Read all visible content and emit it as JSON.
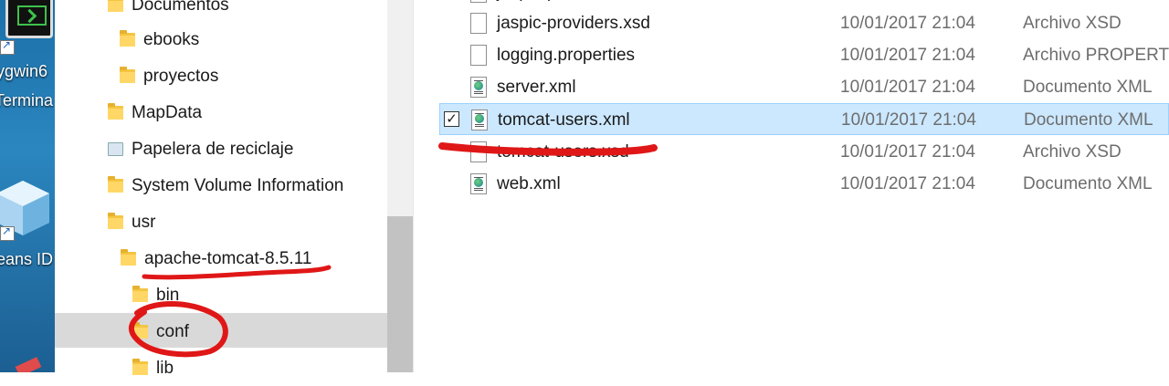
{
  "desktop": {
    "label_cygwin": "ygwin6",
    "label_terminal": "Termina",
    "label_netbeans": "eans ID"
  },
  "nav": {
    "items": [
      {
        "label": "Documentos",
        "icon": "folder-icon"
      },
      {
        "label": "ebooks",
        "icon": "folder-icon"
      },
      {
        "label": "proyectos",
        "icon": "folder-icon"
      },
      {
        "label": "MapData",
        "icon": "folder-icon"
      },
      {
        "label": "Papelera de reciclaje",
        "icon": "recycle-bin-icon"
      },
      {
        "label": "System Volume Information",
        "icon": "folder-icon"
      },
      {
        "label": "usr",
        "icon": "folder-icon"
      },
      {
        "label": "apache-tomcat-8.5.11",
        "icon": "folder-icon"
      },
      {
        "label": "bin",
        "icon": "folder-icon"
      },
      {
        "label": "conf",
        "icon": "folder-icon",
        "selected": true
      },
      {
        "label": "lib",
        "icon": "folder-icon"
      }
    ]
  },
  "files": {
    "rows": [
      {
        "name": "jaspic-providers.xml",
        "date": "",
        "type": ""
      },
      {
        "name": "jaspic-providers.xsd",
        "date": "10/01/2017 21:04",
        "type": "Archivo XSD"
      },
      {
        "name": "logging.properties",
        "date": "10/01/2017 21:04",
        "type": "Archivo PROPERTI"
      },
      {
        "name": "server.xml",
        "date": "10/01/2017 21:04",
        "type": "Documento XML"
      },
      {
        "name": "tomcat-users.xml",
        "date": "10/01/2017 21:04",
        "type": "Documento XML",
        "selected": true
      },
      {
        "name": "tomcat-users.xsd",
        "date": "10/01/2017 21:04",
        "type": "Archivo XSD"
      },
      {
        "name": "web.xml",
        "date": "10/01/2017 21:04",
        "type": "Documento XML"
      }
    ]
  },
  "annotations": {
    "color": "#e01717",
    "marks": [
      "underline-apache-tomcat",
      "circle-conf",
      "underline-tomcat-users"
    ]
  },
  "colors": {
    "selection_row": "#cce8ff",
    "selection_nav": "#d9d9d9",
    "folder": "#f5c542"
  }
}
